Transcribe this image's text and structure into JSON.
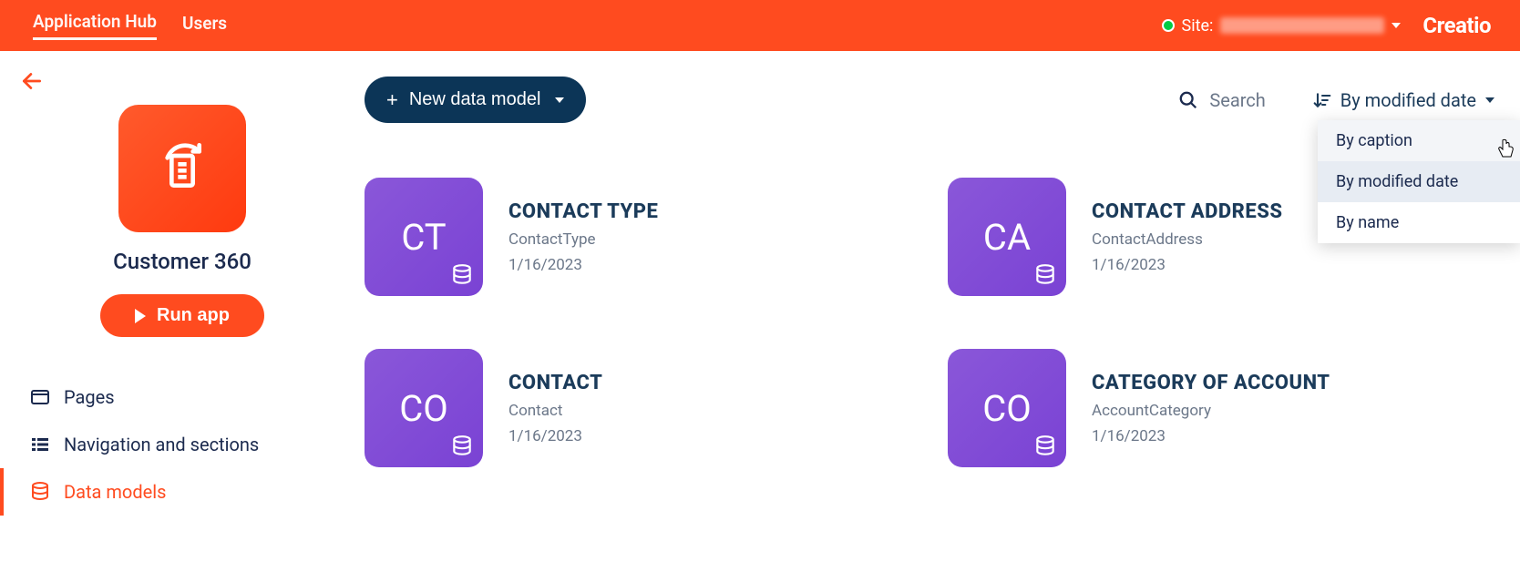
{
  "header": {
    "tabs": [
      "Application Hub",
      "Users"
    ],
    "active_tab": "Application Hub",
    "site_label": "Site:",
    "brand": "Creatio"
  },
  "sidebar": {
    "app_name": "Customer 360",
    "run_button": "Run app",
    "items": [
      {
        "label": "Pages",
        "icon": "page-icon"
      },
      {
        "label": "Navigation and sections",
        "icon": "list-icon"
      },
      {
        "label": "Data models",
        "icon": "database-icon"
      }
    ],
    "active_index": 2
  },
  "toolbar": {
    "new_button": "New data model",
    "search_placeholder": "Search",
    "sort_label": "By modified date",
    "sort_options": [
      "By caption",
      "By modified date",
      "By name"
    ],
    "sort_selected_index": 1,
    "sort_hover_index": 0
  },
  "cards": [
    {
      "abbr": "CT",
      "title": "CONTACT TYPE",
      "name": "ContactType",
      "date": "1/16/2023"
    },
    {
      "abbr": "CA",
      "title": "CONTACT ADDRESS",
      "name": "ContactAddress",
      "date": "1/16/2023"
    },
    {
      "abbr": "CO",
      "title": "CONTACT",
      "name": "Contact",
      "date": "1/16/2023"
    },
    {
      "abbr": "CO",
      "title": "CATEGORY OF ACCOUNT",
      "name": "AccountCategory",
      "date": "1/16/2023"
    }
  ]
}
